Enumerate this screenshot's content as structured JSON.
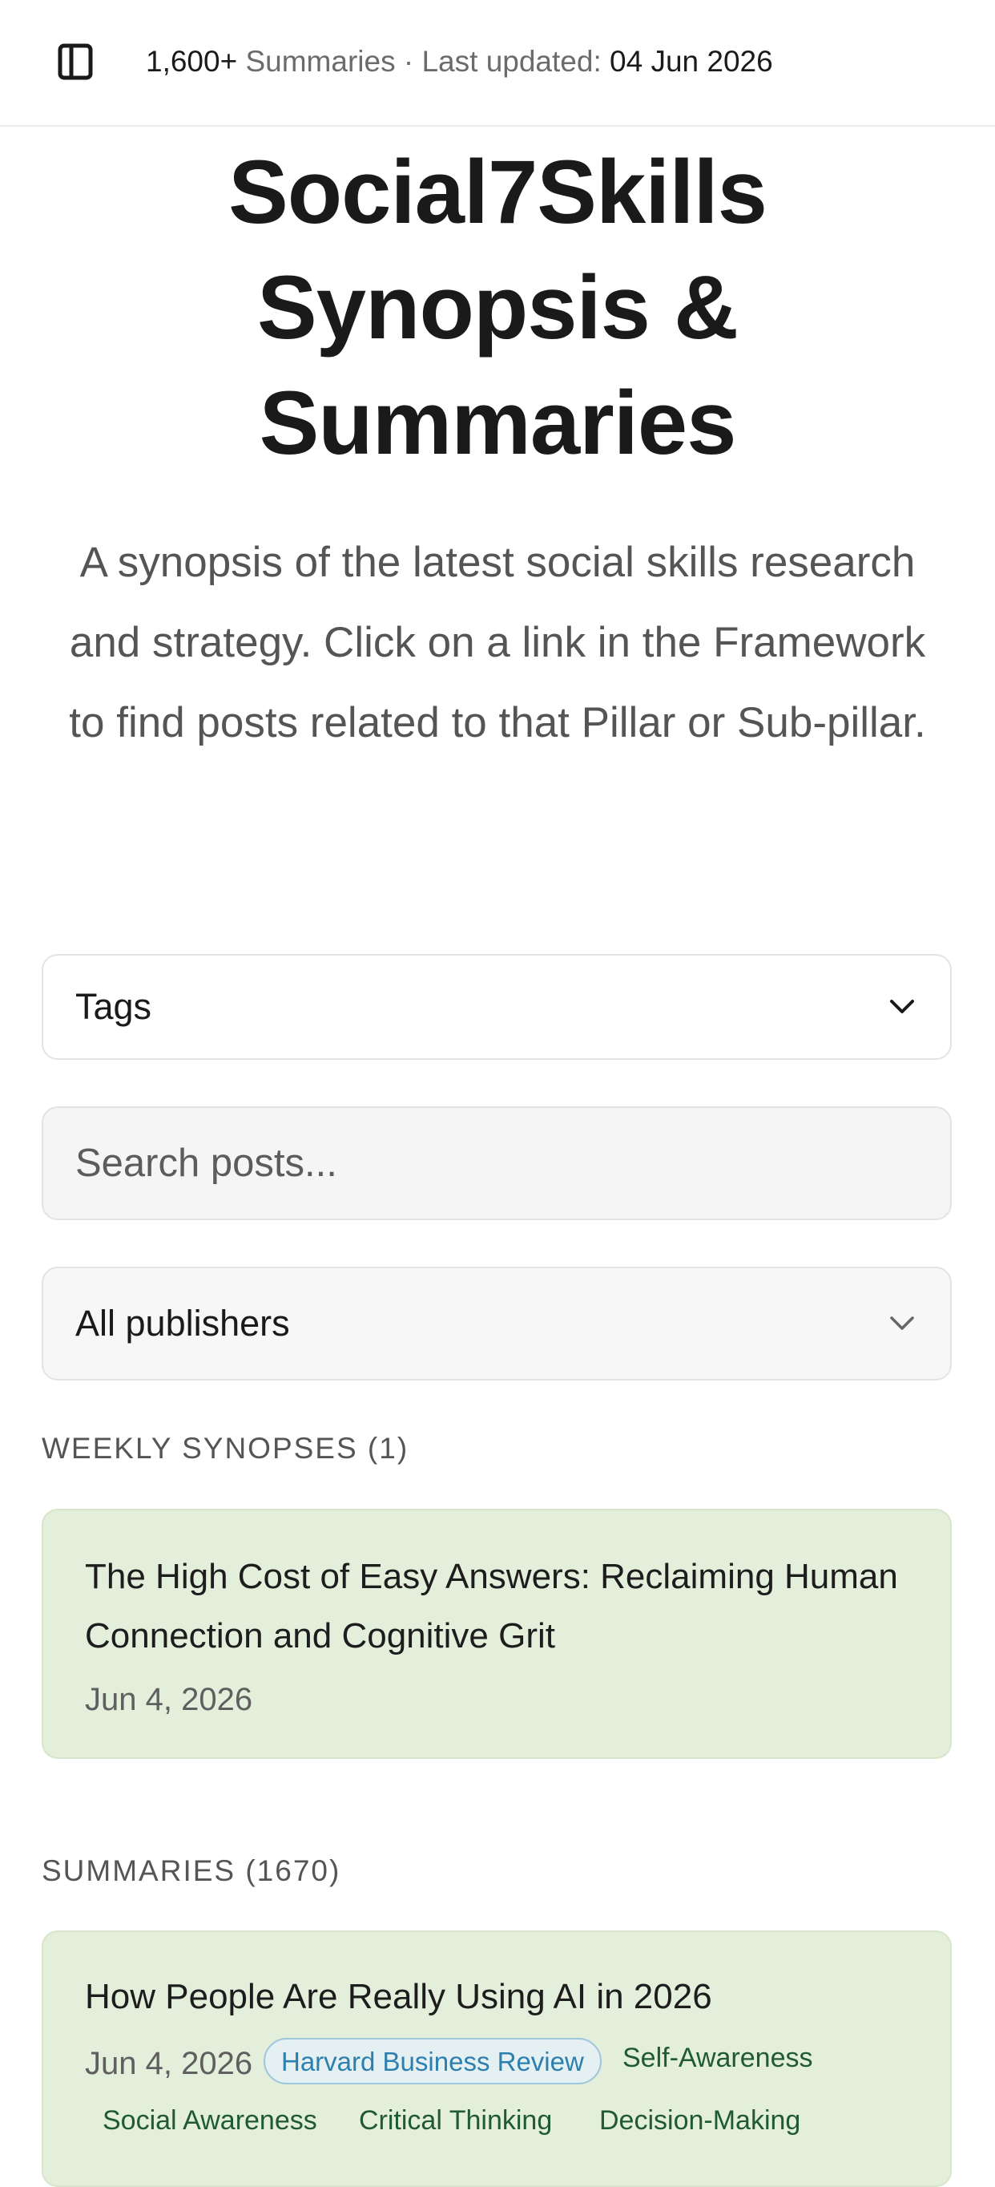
{
  "topbar": {
    "count": "1,600+",
    "summaries_word": "Summaries",
    "separator": "·",
    "last_updated_label": "Last updated:",
    "last_updated_date": "04 Jun 2026"
  },
  "header": {
    "title_line1": "Social7Skills",
    "title_line2": "Synopsis &",
    "title_line3": "Summaries",
    "subtitle": "A synopsis of the latest social skills research and strategy. Click on a link in the Framework to find posts related to that Pillar or Sub-pillar."
  },
  "filters": {
    "tags_label": "Tags",
    "search_placeholder": "Search posts...",
    "publisher_selected": "All publishers"
  },
  "weekly": {
    "label": "WEEKLY SYNOPSES (1)",
    "items": [
      {
        "title": "The High Cost of Easy Answers: Reclaiming Human Connection and Cognitive Grit",
        "date": "Jun 4, 2026"
      }
    ]
  },
  "summaries": {
    "label": "SUMMARIES (1670)",
    "items": [
      {
        "title": "How People Are Really Using AI in 2026",
        "date": "Jun 4, 2026",
        "publisher": "Harvard Business Review",
        "tags": [
          "Self-Awareness",
          "Social Awareness",
          "Critical Thinking",
          "Decision-Making"
        ]
      }
    ]
  },
  "colors": {
    "card_bg": "#e3eedb",
    "tag_text": "#1f5a34",
    "publisher_badge": "#2d7fae"
  },
  "icons": {
    "sidebar_toggle": "sidebar-panel-icon",
    "dropdown": "chevron-down-icon"
  }
}
